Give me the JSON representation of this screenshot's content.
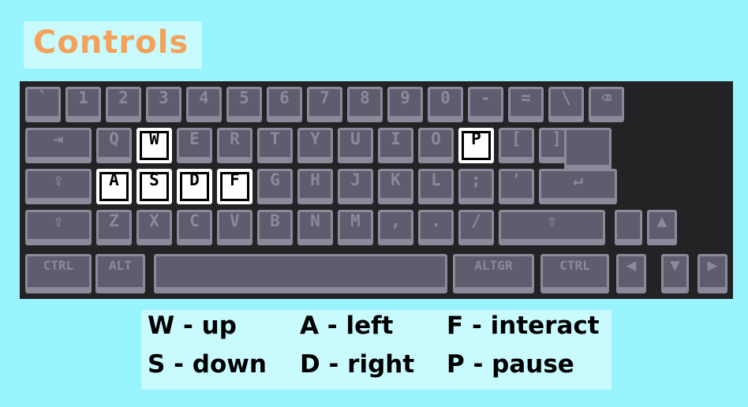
{
  "title": "Controls",
  "keyboard": {
    "row1": [
      "`",
      "1",
      "2",
      "3",
      "4",
      "5",
      "6",
      "7",
      "8",
      "9",
      "0",
      "-",
      "=",
      "\\",
      "⌫"
    ],
    "row2": [
      "⇥",
      "Q",
      "W",
      "E",
      "R",
      "T",
      "Y",
      "U",
      "I",
      "O",
      "P",
      "[",
      "]"
    ],
    "row3": [
      "⇪",
      "A",
      "S",
      "D",
      "F",
      "G",
      "H",
      "J",
      "K",
      "L",
      ";",
      "'",
      "↵"
    ],
    "row4": [
      "⇧",
      "Z",
      "X",
      "C",
      "V",
      "B",
      "N",
      "M",
      ",",
      ".",
      "/",
      "⇧",
      "",
      "▲"
    ],
    "row5": [
      "CTRL",
      "ALT",
      "",
      "ALTGR",
      "CTRL",
      "◀",
      "▼",
      "▶"
    ],
    "highlighted": [
      "W",
      "A",
      "S",
      "D",
      "F",
      "P"
    ]
  },
  "legend": [
    "W - up",
    "A - left",
    "F - interact",
    "S - down",
    "D - right",
    "P - pause"
  ],
  "colors": {
    "background": "#98f4fd",
    "title": "#f4a15a",
    "panel": "#c8fafe",
    "keyboard_bg": "#232325",
    "key": "#5e5d6d",
    "key_border": "#8a8a9b",
    "highlight": "#ffffff"
  }
}
